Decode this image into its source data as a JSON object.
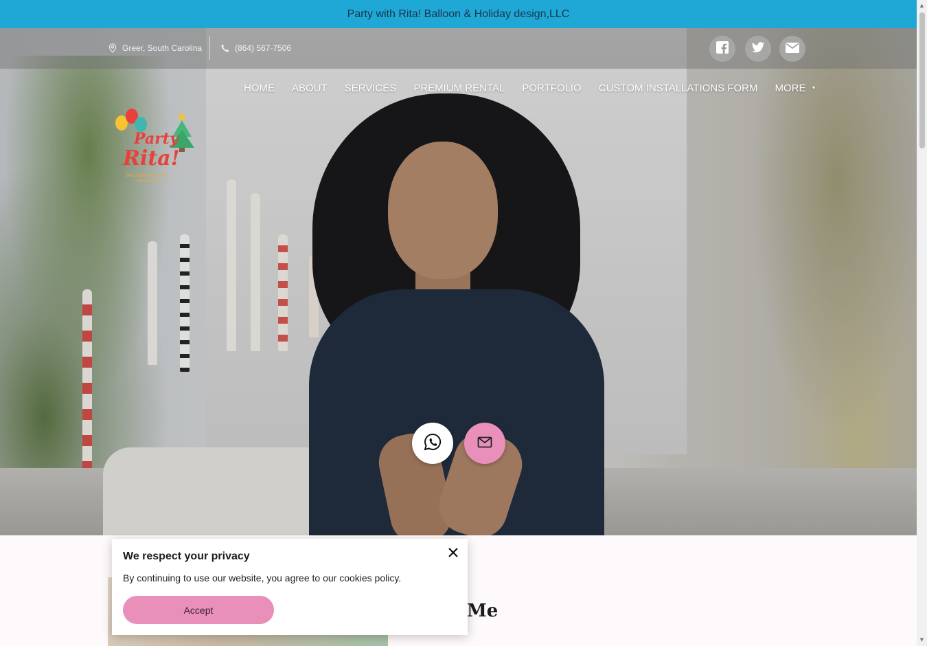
{
  "announcement": {
    "text": "Party with Rita! Balloon & Holiday design,LLC"
  },
  "topbar": {
    "location": "Greer, South Carolina",
    "phone": "(864) 567-7506",
    "social": [
      {
        "name": "facebook-icon",
        "label": "Facebook"
      },
      {
        "name": "twitter-icon",
        "label": "Twitter"
      },
      {
        "name": "email-icon",
        "label": "Email"
      }
    ]
  },
  "nav": {
    "items": [
      "HOME",
      "ABOUT",
      "SERVICES",
      "PREMIUM RENTAL",
      "PORTFOLIO",
      "CUSTOM INSTALLATIONS FORM"
    ],
    "more_label": "MORE"
  },
  "logo": {
    "line1": "Party",
    "line2": "Rita!",
    "tagline1": "BALLOON & HOLIDAY",
    "tagline2": "DESIGN LLC"
  },
  "about": {
    "title_visible": "Me"
  },
  "cookie": {
    "title": "We respect your privacy",
    "text": "By continuing to use our website, you agree to our cookies policy.",
    "accept_label": "Accept"
  },
  "colors": {
    "announce_bg": "#1fa8d6",
    "accent_pink": "#e88fba",
    "nav_text": "#ffffff"
  }
}
